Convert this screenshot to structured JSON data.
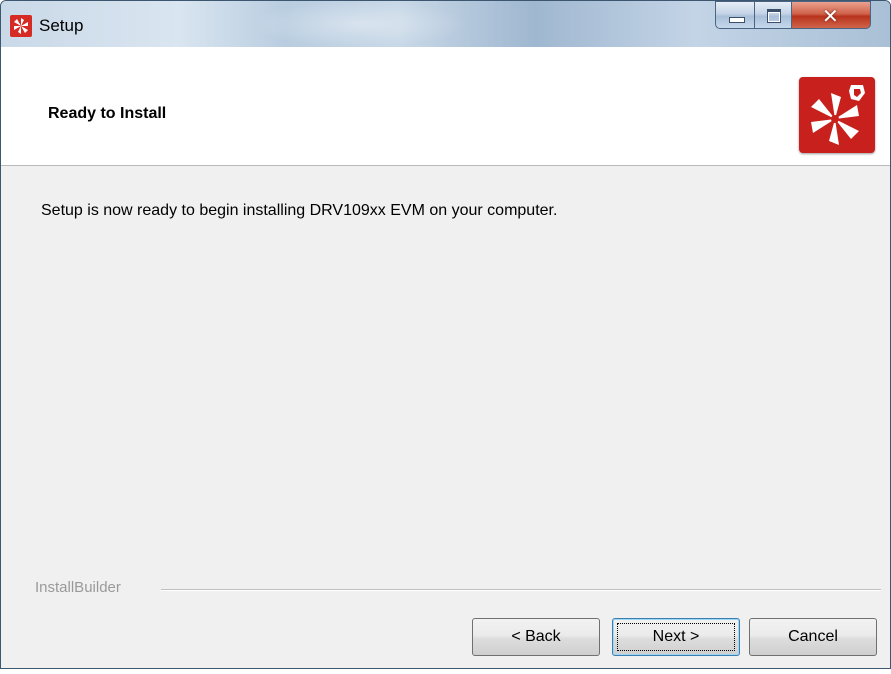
{
  "window": {
    "title": "Setup",
    "controls": {
      "minimize": "minimize",
      "maximize": "maximize",
      "close": "close"
    }
  },
  "header": {
    "title": "Ready to Install",
    "logo_icon": "installer-logo-icon"
  },
  "body": {
    "message": "Setup is now ready to begin installing DRV109xx EVM on your computer."
  },
  "footer": {
    "brand": "InstallBuilder",
    "buttons": {
      "back": "< Back",
      "next": "Next >",
      "cancel": "Cancel"
    }
  },
  "colors": {
    "logo_red": "#c8201c",
    "close_red": "#c74b33",
    "title_blue": "#b9cde0"
  }
}
